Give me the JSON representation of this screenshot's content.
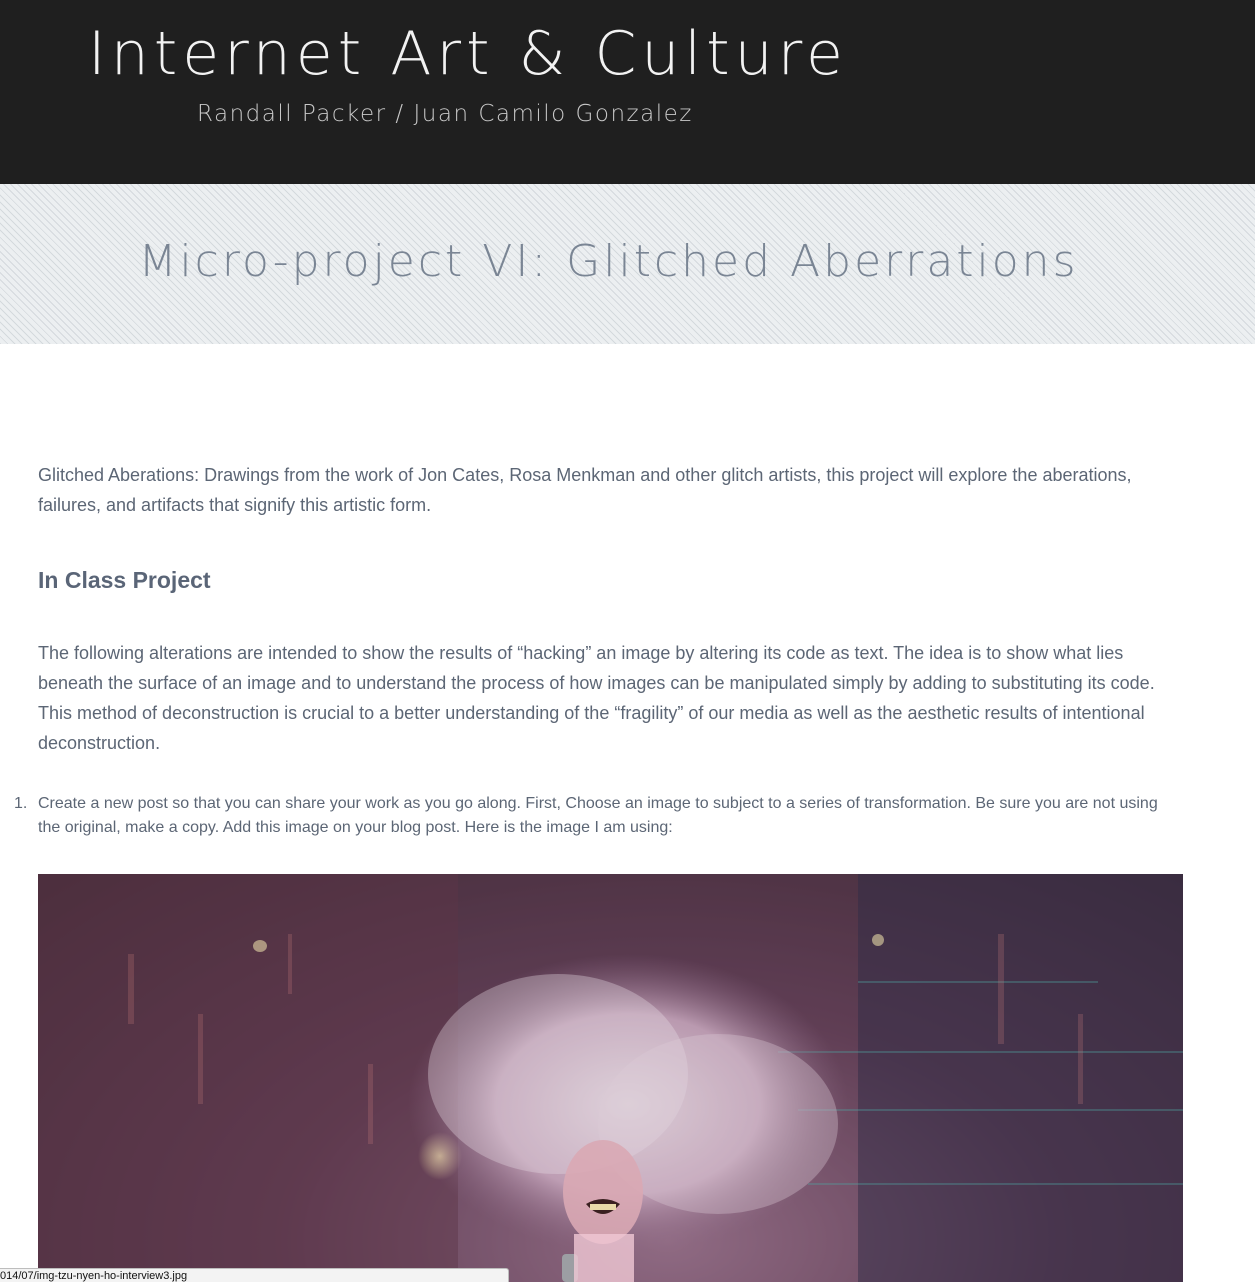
{
  "header": {
    "site_title": "Internet Art & Culture",
    "site_subtitle": "Randall Packer / Juan Camilo Gonzalez"
  },
  "banner": {
    "page_title": "Micro-project VI: Glitched Aberrations"
  },
  "content": {
    "intro": "Glitched Aberations: Drawings from the work of Jon Cates, Rosa Menkman and other glitch artists, this project will explore the aberations, failures, and artifacts that signify this artistic form.",
    "section_heading": "In Class Project",
    "body": "The following alterations are intended to show the results of “hacking” an image by altering its code as text. The idea is to show what lies beneath the surface of an image and to understand the process of how images can be manipulated simply by adding to substituting its code. This method of deconstruction is crucial to a better understanding of the “fragility” of our media as well as the aesthetic results of intentional deconstruction.",
    "steps": [
      {
        "number": "1.",
        "text": "Create a new post so that you can share your work as you go along. First, Choose an image to subject to a series of transformation. Be sure you are not using the original, make a copy. Add this image on your blog post. Here is the image I am using:"
      }
    ]
  },
  "status_bar": {
    "url": "014/07/img-tzu-nyen-ho-interview3.jpg"
  },
  "colors": {
    "header_bg": "#1f1f1f",
    "banner_bg": "#eceff1",
    "body_text": "#5c6675",
    "title_text": "#7a8594"
  }
}
